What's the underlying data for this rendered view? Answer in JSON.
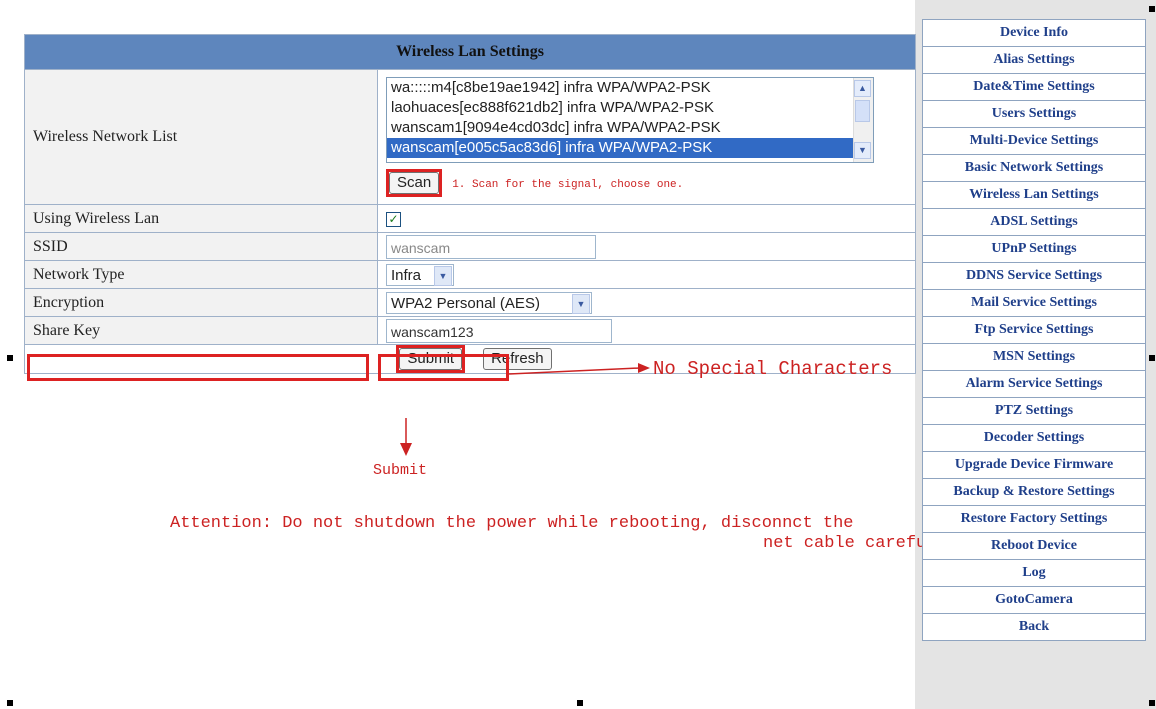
{
  "wireless": {
    "title": "Wireless Lan Settings",
    "network_list_label": "Wireless Network List",
    "networks": [
      "wa:::::m4[c8be19ae1942] infra WPA/WPA2-PSK",
      "laohuaces[ec888f621db2] infra WPA/WPA2-PSK",
      "wanscam1[9094e4cd03dc] infra WPA/WPA2-PSK",
      "wanscam[e005c5ac83d6] infra WPA/WPA2-PSK"
    ],
    "scan_label": "Scan",
    "scan_hint": "1. Scan for the signal, choose one.",
    "using_label": "Using Wireless Lan",
    "ssid_label": "SSID",
    "ssid_value": "wanscam",
    "network_type_label": "Network Type",
    "network_type_value": "Infra",
    "encryption_label": "Encryption",
    "encryption_value": "WPA2 Personal (AES)",
    "share_key_label": "Share Key",
    "share_key_value": "wanscam123",
    "submit_label": "Submit",
    "refresh_label": "Refresh"
  },
  "annotations": {
    "no_special": "No Special Characters",
    "submit": "Submit",
    "attention_line1": "Attention: Do not shutdown the power while rebooting, disconnct the",
    "attention_line2": "net cable carefully!"
  },
  "menu": [
    "Device Info",
    "Alias Settings",
    "Date&Time Settings",
    "Users Settings",
    "Multi-Device Settings",
    "Basic Network Settings",
    "Wireless Lan Settings",
    "ADSL Settings",
    "UPnP Settings",
    "DDNS Service Settings",
    "Mail Service Settings",
    "Ftp Service Settings",
    "MSN Settings",
    "Alarm Service Settings",
    "PTZ Settings",
    "Decoder Settings",
    "Upgrade Device Firmware",
    "Backup & Restore Settings",
    "Restore Factory Settings",
    "Reboot Device",
    "Log",
    "GotoCamera",
    "Back"
  ],
  "colors": {
    "header": "#5e86bd",
    "annotation": "#cc2222",
    "menu_text": "#1f3f8a",
    "selected": "#316ac5"
  }
}
